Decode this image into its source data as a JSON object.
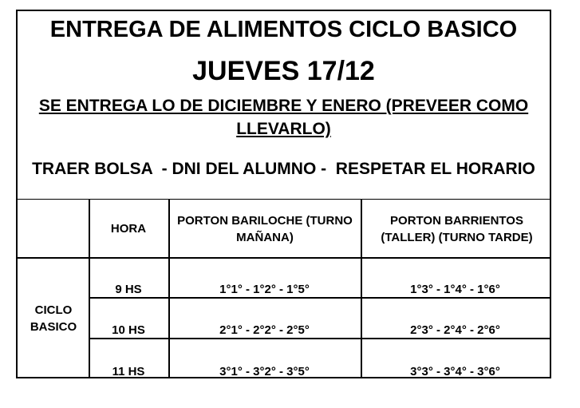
{
  "header": {
    "title": "ENTREGA DE ALIMENTOS CICLO BASICO",
    "date": "JUEVES 17/12",
    "note": "SE ENTREGA LO DE DICIEMBRE Y ENERO (PREVEER COMO LLEVARLO)",
    "requirements": "TRAER BOLSA  - DNI DEL ALUMNO -  RESPETAR EL HORARIO"
  },
  "table": {
    "columns": [
      "HORA",
      "PORTON BARILOCHE  (TURNO MAÑANA)",
      "PORTON BARRIENTOS (TALLER) (TURNO TARDE)"
    ],
    "group_label": "CICLO BASICO",
    "rows": [
      {
        "hora": "9 HS",
        "bariloche": "1°1° - 1°2° - 1°5°",
        "barrientos": "1°3° - 1°4° - 1°6°"
      },
      {
        "hora": "10 HS",
        "bariloche": "2°1° - 2°2° - 2°5°",
        "barrientos": "2°3° - 2°4° - 2°6°"
      },
      {
        "hora": "11 HS",
        "bariloche": "3°1° - 3°2° - 3°5°",
        "barrientos": "3°3° - 3°4° - 3°6°"
      }
    ]
  }
}
